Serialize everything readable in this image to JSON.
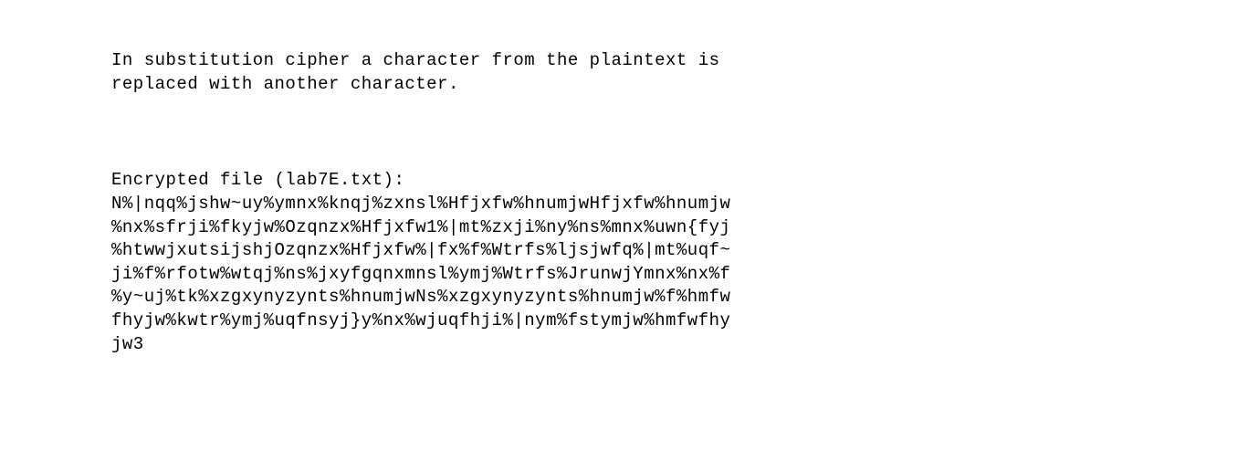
{
  "intro": {
    "line1": "In substitution cipher a character from the plaintext is",
    "line2": "replaced with another character."
  },
  "encrypted": {
    "label": "Encrypted file (lab7E.txt):",
    "lines": {
      "l1": "N%|nqq%jshw~uy%ymnx%knqj%zxnsl%Hfjxfw%hnumjwHfjxfw%hnumjw",
      "l2": "%nx%sfrji%fkyjw%Ozqnzx%Hfjxfw1%|mt%zxji%ny%ns%mnx%uwn{fyj",
      "l3": "%htwwjxutsijshjOzqnzx%Hfjxfw%|fx%f%Wtrfs%ljsjwfq%|mt%uqf~",
      "l4": "ji%f%rfotw%wtqj%ns%jxyfgqnxmnsl%ymj%Wtrfs%JrunwjYmnx%nx%f",
      "l5": "%y~uj%tk%xzgxynyzynts%hnumjwNs%xzgxynyzynts%hnumjw%f%hmfw",
      "l6": "fhyjw%kwtr%ymj%uqfnsyj}y%nx%wjuqfhji%|nym%fstymjw%hmfwfhy",
      "l7": "jw3"
    }
  }
}
